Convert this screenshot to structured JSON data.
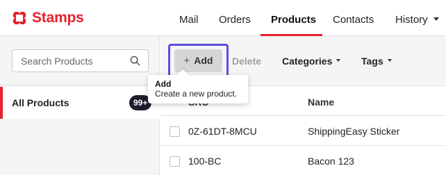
{
  "brand": {
    "name": "Stamps",
    "color": "#e8202e",
    "logo_icon": "stamp-logo-icon"
  },
  "nav": {
    "items": [
      {
        "label": "Mail",
        "active": false
      },
      {
        "label": "Orders",
        "active": false
      },
      {
        "label": "Products",
        "active": true
      },
      {
        "label": "Contacts",
        "active": false
      },
      {
        "label": "History",
        "active": false,
        "dropdown": true
      }
    ]
  },
  "sidebar": {
    "search": {
      "placeholder": "Search Products",
      "value": "",
      "icon": "search-icon"
    },
    "items": [
      {
        "label": "All Products",
        "badge": "99+",
        "active": true
      }
    ]
  },
  "toolbar": {
    "add_label": "Add",
    "add_icon": "plus-icon",
    "delete_label": "Delete",
    "categories_label": "Categories",
    "tags_label": "Tags",
    "focus_color": "#5b4ee0"
  },
  "tooltip": {
    "title": "Add",
    "description": "Create a new product."
  },
  "table": {
    "columns": [
      "SKU",
      "Name"
    ],
    "rows": [
      {
        "sku": "0Z-61DT-8MCU",
        "name": "ShippingEasy Sticker"
      },
      {
        "sku": "100-BC",
        "name": "Bacon 123"
      }
    ]
  }
}
